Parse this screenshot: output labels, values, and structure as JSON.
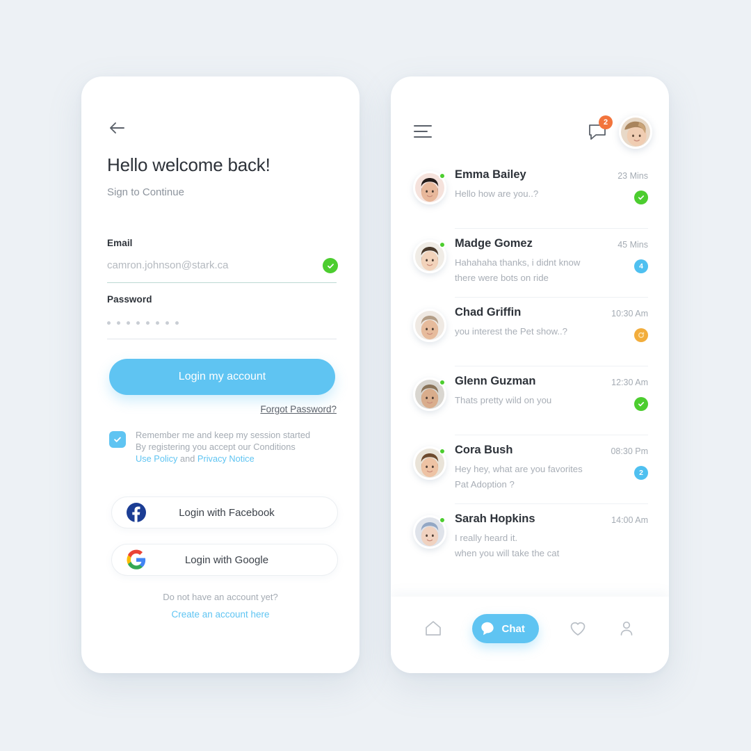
{
  "login": {
    "back_icon": "arrow-left-icon",
    "title": "Hello welcome back!",
    "subtitle": "Sign to Continue",
    "email": {
      "label": "Email",
      "value": "camron.johnson@stark.ca",
      "placeholder": "camron.johnson@stark.ca",
      "valid_icon": "check-circle-icon"
    },
    "password": {
      "label": "Password",
      "value": "••••••••",
      "dots": 8
    },
    "submit_label": "Login my account",
    "forgot_label": "Forgot Password?",
    "terms": {
      "line1": "Remember me and keep my session started",
      "line2": "By registering you accept our Conditions",
      "link1": "Use Policy",
      "between": " and ",
      "link2": "Privacy Notice",
      "checked": true
    },
    "facebook_label": "Login with Facebook",
    "google_label": "Login with Google",
    "signup_prompt": "Do not have an account yet?",
    "signup_link": "Create an account here"
  },
  "chat": {
    "header": {
      "menu_icon": "hamburger-menu-icon",
      "notification_icon": "chat-bubble-icon",
      "notification_count": "2",
      "avatar_icon": "user-avatar"
    },
    "rows": [
      {
        "name": "Emma Bailey",
        "time": "23 Mins",
        "messages": [
          "Hello how are you..?"
        ],
        "badge": {
          "type": "green",
          "text": ""
        },
        "online": true,
        "avatar_icon": "avatar-emma-bailey"
      },
      {
        "name": "Madge Gomez",
        "time": "45 Mins",
        "messages": [
          "Hahahaha thanks, i didnt know",
          "there were bots on ride"
        ],
        "badge": {
          "type": "blue",
          "text": "4"
        },
        "online": true,
        "avatar_icon": "avatar-madge-gomez"
      },
      {
        "name": "Chad Griffin",
        "time": "10:30 Am",
        "messages": [
          "you interest the Pet show..?"
        ],
        "badge": {
          "type": "orange",
          "text": ""
        },
        "online": false,
        "avatar_icon": "avatar-chad-griffin"
      },
      {
        "name": "Glenn Guzman",
        "time": "12:30 Am",
        "messages": [
          "Thats pretty wild on you"
        ],
        "badge": {
          "type": "green",
          "text": ""
        },
        "online": true,
        "avatar_icon": "avatar-glenn-guzman"
      },
      {
        "name": "Cora Bush",
        "time": "08:30 Pm",
        "messages": [
          "Hey hey, what are you favorites",
          "Pat Adoption ?"
        ],
        "badge": {
          "type": "blue",
          "text": "2"
        },
        "online": true,
        "avatar_icon": "avatar-cora-bush"
      },
      {
        "name": "Sarah Hopkins",
        "time": "14:00 Am",
        "messages": [
          "I really heard it.",
          "when you will take the cat"
        ],
        "badge": null,
        "online": true,
        "avatar_icon": "avatar-sarah-hopkins"
      }
    ],
    "nav": [
      {
        "icon": "home-icon",
        "label": "",
        "active": false
      },
      {
        "icon": "chat-bubble-icon",
        "label": "Chat",
        "active": true
      },
      {
        "icon": "heart-icon",
        "label": "",
        "active": false
      },
      {
        "icon": "person-icon",
        "label": "",
        "active": false
      }
    ]
  },
  "colors": {
    "background": "#edf1f5",
    "accent": "#5fc4f2",
    "success": "#4ccd2f",
    "warning": "#f2ad3c",
    "badge_blue": "#4fc0f0",
    "notification": "#f2743c"
  }
}
